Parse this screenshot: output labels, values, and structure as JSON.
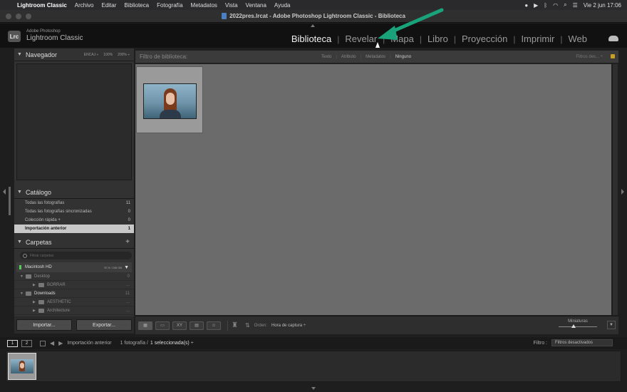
{
  "menubar": {
    "app": "Lightroom Classic",
    "items": [
      "Archivo",
      "Editar",
      "Biblioteca",
      "Fotografía",
      "Metadatos",
      "Vista",
      "Ventana",
      "Ayuda"
    ],
    "clock": "Vie 2 jun  17:06"
  },
  "window": {
    "title": "2022pres.lrcat - Adobe Photoshop Lightroom Classic - Biblioteca"
  },
  "identity": {
    "logo": "Lrc",
    "brand_top": "Adobe Photoshop",
    "brand_bottom": "Lightroom Classic",
    "modules": [
      "Biblioteca",
      "Revelar",
      "Mapa",
      "Libro",
      "Proyección",
      "Imprimir",
      "Web"
    ],
    "active_module": "Biblioteca"
  },
  "navigator": {
    "title": "Navegador",
    "zoom_options": [
      "ENCAJ ÷",
      "100%",
      "200% ÷"
    ]
  },
  "catalog": {
    "title": "Catálogo",
    "items": [
      {
        "label": "Todas las fotografías",
        "count": "11"
      },
      {
        "label": "Todas las fotografías sincronizadas",
        "count": "0"
      },
      {
        "label": "Colección rápida  +",
        "count": "0"
      },
      {
        "label": "Importación anterior",
        "count": "1"
      }
    ],
    "selected_index": 3
  },
  "folders": {
    "title": "Carpetas",
    "add_label": "+",
    "search_placeholder": "Filtrar carpetas",
    "volume": {
      "name": "Macintosh HD",
      "capacity": "57,9 / 245 GB"
    },
    "rows": [
      {
        "name": "Desktop",
        "count": "0"
      },
      {
        "name": "BORRAR",
        "count": "..."
      },
      {
        "name": "Downloads",
        "count": "11"
      },
      {
        "name": "AESTHETIC",
        "count": "..."
      },
      {
        "name": "Architecture",
        "count": "..."
      }
    ]
  },
  "panel_buttons": {
    "import": "Importar...",
    "export": "Exportar..."
  },
  "filterbar": {
    "label": "Filtro de biblioteca:",
    "options": [
      "Texto",
      "Atributo",
      "Metadatos",
      "Ninguno"
    ],
    "active_option": "Ninguno",
    "right_label": "Filtros des... ÷"
  },
  "toolbar": {
    "sort_label": "Orden:",
    "sort_value": "Hora de captura ÷",
    "thumbnails_label": "Miniaturas",
    "thumbnail_size": 0.39
  },
  "filmstrip_bar": {
    "screens": [
      "1",
      "2"
    ],
    "source": "Importación anterior",
    "count_text": "1 fotografía /",
    "selection_text": "1 seleccionada(s) ÷",
    "filter_label": "Filtro :",
    "filter_value": "Filtros desactivados"
  }
}
